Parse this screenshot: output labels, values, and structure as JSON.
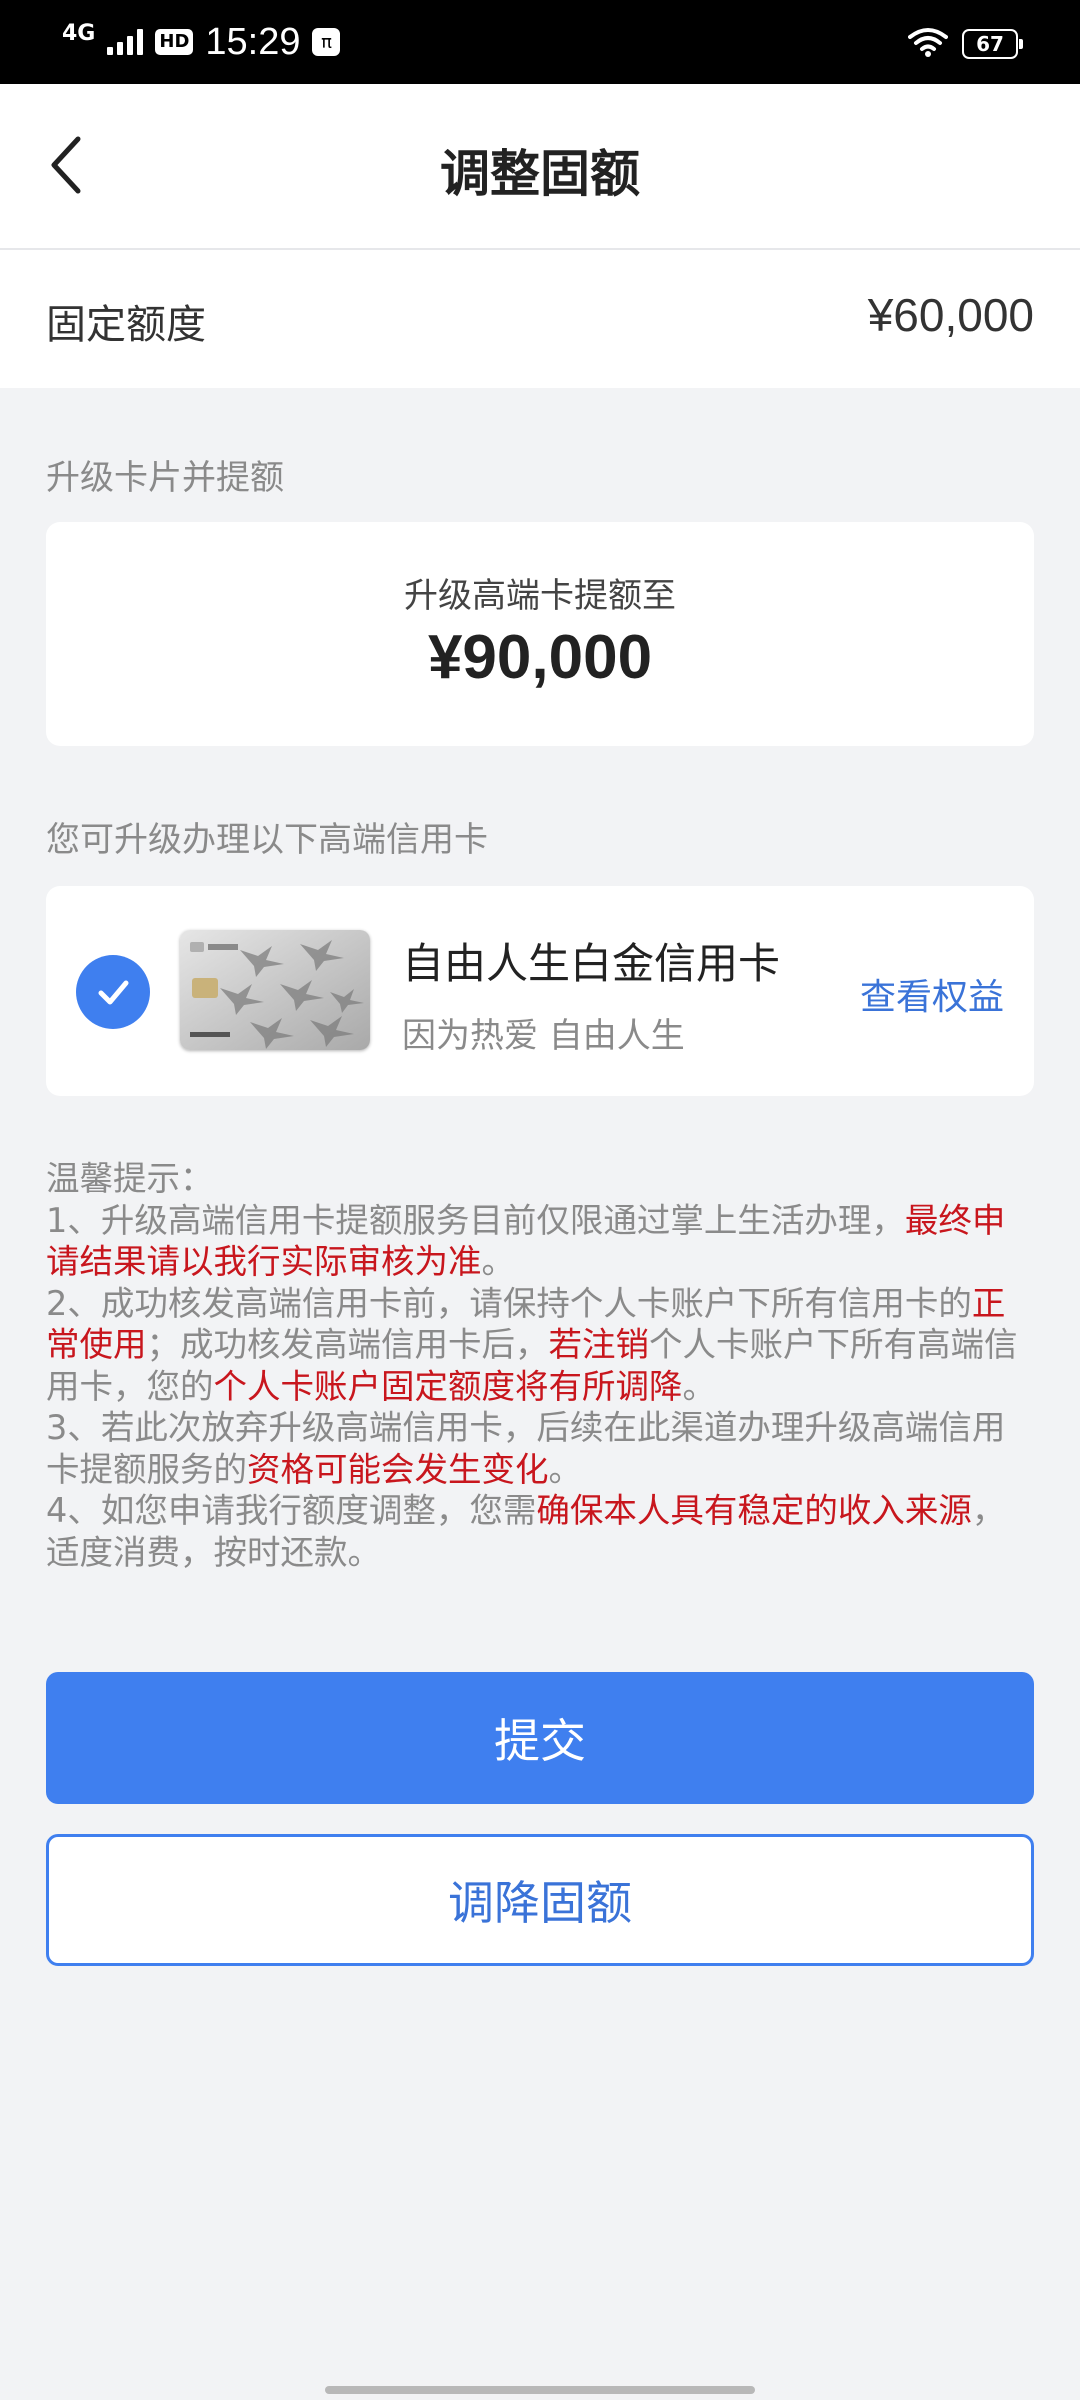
{
  "status_bar": {
    "network": "4G",
    "hd_badge": "HD",
    "time": "15:29",
    "app_badge": "π",
    "battery": "67"
  },
  "nav": {
    "title": "调整固额"
  },
  "fixed_limit": {
    "label": "固定额度",
    "value": "¥60,000"
  },
  "upgrade": {
    "section_label": "升级卡片并提额",
    "promo_subtitle": "升级高端卡提额至",
    "promo_amount": "¥90,000"
  },
  "cards": {
    "section_label": "您可升级办理以下高端信用卡",
    "items": [
      {
        "name": "自由人生白金信用卡",
        "slogan": "因为热爱 自由人生",
        "link": "查看权益",
        "selected": true
      }
    ]
  },
  "tips": {
    "title": "温馨提示：",
    "p1_a": "1、升级高端信用卡提额服务目前仅限通过掌上生活办理，",
    "p1_b": "最终申请结果请以我行实际审核为准",
    "p1_c": "。",
    "p2_a": "2、成功核发高端信用卡前，请保持个人卡账户下所有信用卡的",
    "p2_b": "正常使用",
    "p2_c": "；成功核发高端信用卡后，",
    "p2_d": "若注销",
    "p2_e": "个人卡账户下所有高端信用卡，您的",
    "p2_f": "个人卡账户固定额度将有所调降",
    "p2_g": "。",
    "p3_a": "3、若此次放弃升级高端信用卡，后续在此渠道办理升级高端信用卡提额服务的",
    "p3_b": "资格可能会发生变化",
    "p3_c": "。",
    "p4_a": "4、如您申请我行额度调整，您需",
    "p4_b": "确保本人具有稳定的收入来源",
    "p4_c": "，适度消费，按时还款。"
  },
  "actions": {
    "submit": "提交",
    "lower": "调降固额"
  },
  "colors": {
    "accent": "#3f7fef",
    "warning": "#c8161d"
  }
}
